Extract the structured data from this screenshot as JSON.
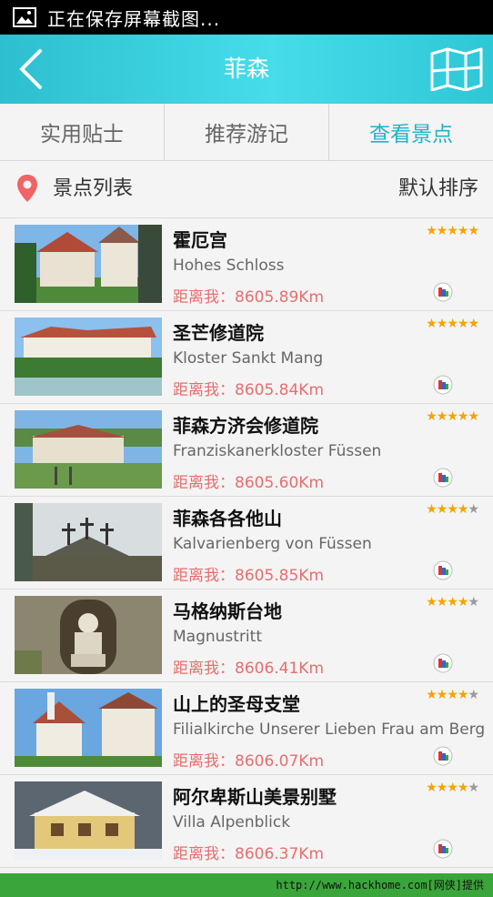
{
  "status_bar": {
    "text": "正在保存屏幕截图...",
    "icon": "image-icon"
  },
  "header": {
    "title": "菲森",
    "back_icon": "chevron-left-icon",
    "map_icon": "map-icon"
  },
  "tabs": [
    {
      "label": "实用贴士",
      "active": false
    },
    {
      "label": "推荐游记",
      "active": false
    },
    {
      "label": "查看景点",
      "active": true
    }
  ],
  "list_header": {
    "title": "景点列表",
    "sort_label": "默认排序",
    "icon": "location-pin-icon"
  },
  "colors": {
    "accent": "#1fb3c8",
    "header": "#3fd4e2",
    "distance": "#e86d6d",
    "star": "#f4a400",
    "bottom_bar": "#3aa53a"
  },
  "attractions": [
    {
      "name": "霍厄宫",
      "subtitle": "Hohes Schloss",
      "distance": "距离我：8605.89Km",
      "rating": 5
    },
    {
      "name": "圣芒修道院",
      "subtitle": "Kloster Sankt Mang",
      "distance": "距离我：8605.84Km",
      "rating": 5
    },
    {
      "name": "菲森方济会修道院",
      "subtitle": "Franziskanerkloster Füssen",
      "distance": "距离我：8605.60Km",
      "rating": 5
    },
    {
      "name": "菲森各各他山",
      "subtitle": "Kalvarienberg von Füssen",
      "distance": "距离我：8605.85Km",
      "rating": 4
    },
    {
      "name": "马格纳斯台地",
      "subtitle": "Magnustritt",
      "distance": "距离我：8606.41Km",
      "rating": 4
    },
    {
      "name": "山上的圣母支堂",
      "subtitle": "Filialkirche Unserer Lieben Frau am Berg",
      "distance": "距离我：8606.07Km",
      "rating": 4
    },
    {
      "name": "阿尔卑斯山美景别墅",
      "subtitle": "Villa Alpenblick",
      "distance": "距离我：8606.37Km",
      "rating": 4
    }
  ],
  "watermark": "http://www.hackhome.com[网侠]提供"
}
